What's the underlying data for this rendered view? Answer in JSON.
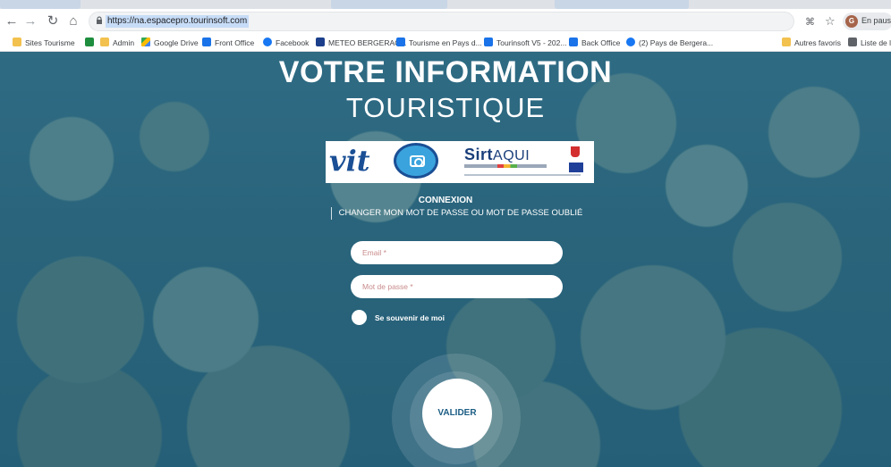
{
  "browser": {
    "url": "https://na.espacepro.tourinsoft.com",
    "profile_initial": "G",
    "profile_status": "En pause"
  },
  "bookmarks": [
    {
      "label": "Sites Tourisme",
      "icon": "folder-icon"
    },
    {
      "label": "",
      "icon": "green-square-icon"
    },
    {
      "label": "Admin",
      "icon": "folder-icon"
    },
    {
      "label": "Google Drive",
      "icon": "google-drive-icon"
    },
    {
      "label": "Front Office",
      "icon": "table-icon"
    },
    {
      "label": "Facebook",
      "icon": "facebook-icon"
    },
    {
      "label": "METEO BERGERAC...",
      "icon": "weather-icon"
    },
    {
      "label": "Tourisme en Pays d...",
      "icon": "site-icon"
    },
    {
      "label": "Tourinsoft V5 - 202...",
      "icon": "table-icon"
    },
    {
      "label": "Back Office",
      "icon": "table-icon"
    },
    {
      "label": "(2) Pays de Bergera...",
      "icon": "facebook-icon"
    },
    {
      "label": "Autres favoris",
      "icon": "folder-icon"
    },
    {
      "label": "Liste de l",
      "icon": "reading-list-icon"
    }
  ],
  "page": {
    "headline_line1": "VOTRE INFORMATION",
    "headline_line2": "TOURISTIQUE",
    "logo": {
      "vit": "vit",
      "sirt": "Sirt",
      "aqui": "AQUI"
    },
    "connexion_title": "CONNEXION",
    "change_password_link": "CHANGER MON MOT DE PASSE OU MOT DE PASSE OUBLIÉ",
    "email_placeholder": "Email *",
    "password_placeholder": "Mot de passe *",
    "remember_label": "Se souvenir de moi",
    "submit_label": "VALIDER"
  },
  "colors": {
    "overlay": "#1f5a78",
    "button_text": "#1b5d84",
    "vit_blue": "#1a4f95"
  }
}
